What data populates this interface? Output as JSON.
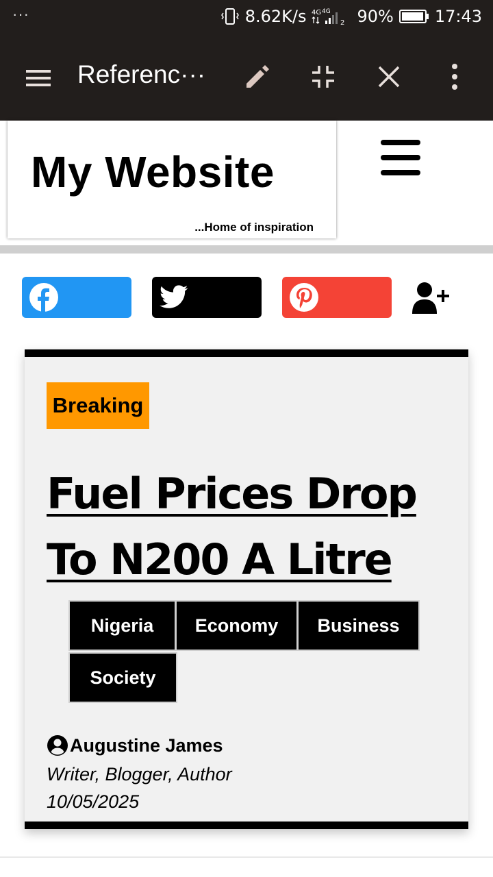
{
  "status_bar": {
    "overflow_dots": "···",
    "net_speed": "8.62K/s",
    "network_type": "4G",
    "battery_percent": "90%",
    "time": "17:43"
  },
  "app_bar": {
    "title": "Referenc···",
    "icons": [
      "menu-icon",
      "edit-pencil-icon",
      "minimize-icon",
      "close-icon",
      "more-vert-icon"
    ]
  },
  "site": {
    "title": "My Website",
    "tagline": "...Home of inspiration"
  },
  "share": {
    "buttons": [
      {
        "icon": "facebook-icon",
        "color": "#2196f3"
      },
      {
        "icon": "twitter-icon",
        "color": "#000000"
      },
      {
        "icon": "pinterest-icon",
        "color": "#f44336"
      }
    ],
    "follow_icon": "user-plus-icon"
  },
  "article": {
    "badge": "Breaking",
    "badge_color": "#ff9800",
    "headline_line1": "Fuel Prices Drop",
    "headline_line2": "To N200 A Litre",
    "tags": [
      "Nigeria",
      "Economy",
      "Business",
      "Society"
    ],
    "author_name": "Augustine James",
    "author_role": "Writer, Blogger, Author",
    "date": "10/05/2025"
  }
}
